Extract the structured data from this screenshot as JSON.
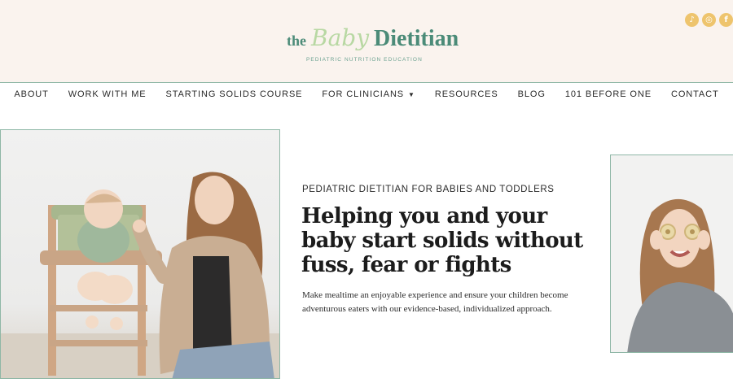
{
  "header": {
    "logo": {
      "the": "the",
      "baby": "Baby",
      "dietitian": "Dietitian"
    },
    "tagline": "PEDIATRIC NUTRITION EDUCATION",
    "social": [
      {
        "icon": "tiktok-icon",
        "glyph": "♪"
      },
      {
        "icon": "instagram-icon",
        "glyph": "◎"
      },
      {
        "icon": "facebook-icon",
        "glyph": "f"
      }
    ]
  },
  "nav": {
    "items": [
      {
        "label": "ABOUT"
      },
      {
        "label": "WORK WITH ME"
      },
      {
        "label": "STARTING SOLIDS COURSE"
      },
      {
        "label": "FOR CLINICIANS",
        "caret": "▼"
      },
      {
        "label": "RESOURCES"
      },
      {
        "label": "BLOG"
      },
      {
        "label": "101 BEFORE ONE"
      },
      {
        "label": "CONTACT"
      }
    ]
  },
  "hero": {
    "eyebrow": "PEDIATRIC DIETITIAN FOR BABIES AND TODDLERS",
    "headline": "Helping you and your baby start solids without fuss, fear or fights",
    "body": "Make mealtime an enjoyable experience and ensure your children become adventurous eaters with our evidence-based, individualized approach."
  },
  "colors": {
    "accent_green": "#4b8b78",
    "light_green": "#b8d8a3",
    "header_bg": "#faf3ee",
    "social_gold": "#eec46d",
    "border_green": "#8fb7a6"
  }
}
